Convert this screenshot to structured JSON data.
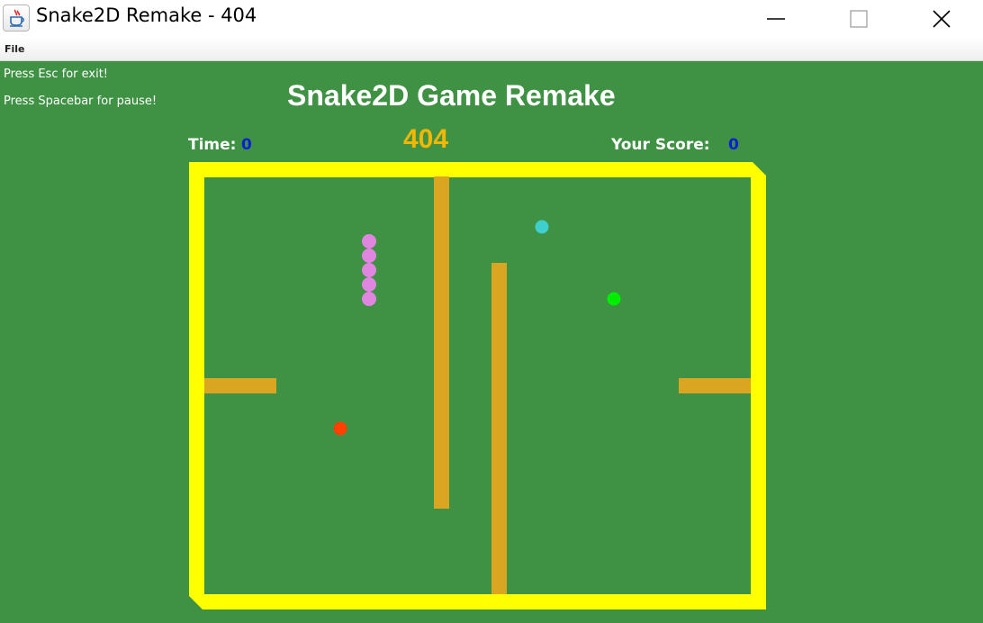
{
  "window": {
    "title": "Snake2D Remake - 404",
    "app_icon": "java-cup-icon",
    "controls": [
      "minimize-icon",
      "maximize-icon",
      "close-icon"
    ]
  },
  "menu": {
    "file_label": "File"
  },
  "hints": {
    "exit": "Press Esc for exit!",
    "pause": "Press Spacebar for pause!"
  },
  "game": {
    "title": "Snake2D Game Remake",
    "level": "404",
    "time_label": "Time:",
    "time_value": "0",
    "score_label": "Your Score:",
    "score_value": "0"
  },
  "colors": {
    "background": "#3f9143",
    "border": "#ffff00",
    "obstacle": "#daa520",
    "snake": "#e085e0",
    "food_cyan": "#40cfcf",
    "food_green": "#00ee00",
    "food_red": "#ff4000",
    "level_text": "#f2b705",
    "counter_text": "#0b1fd6"
  }
}
